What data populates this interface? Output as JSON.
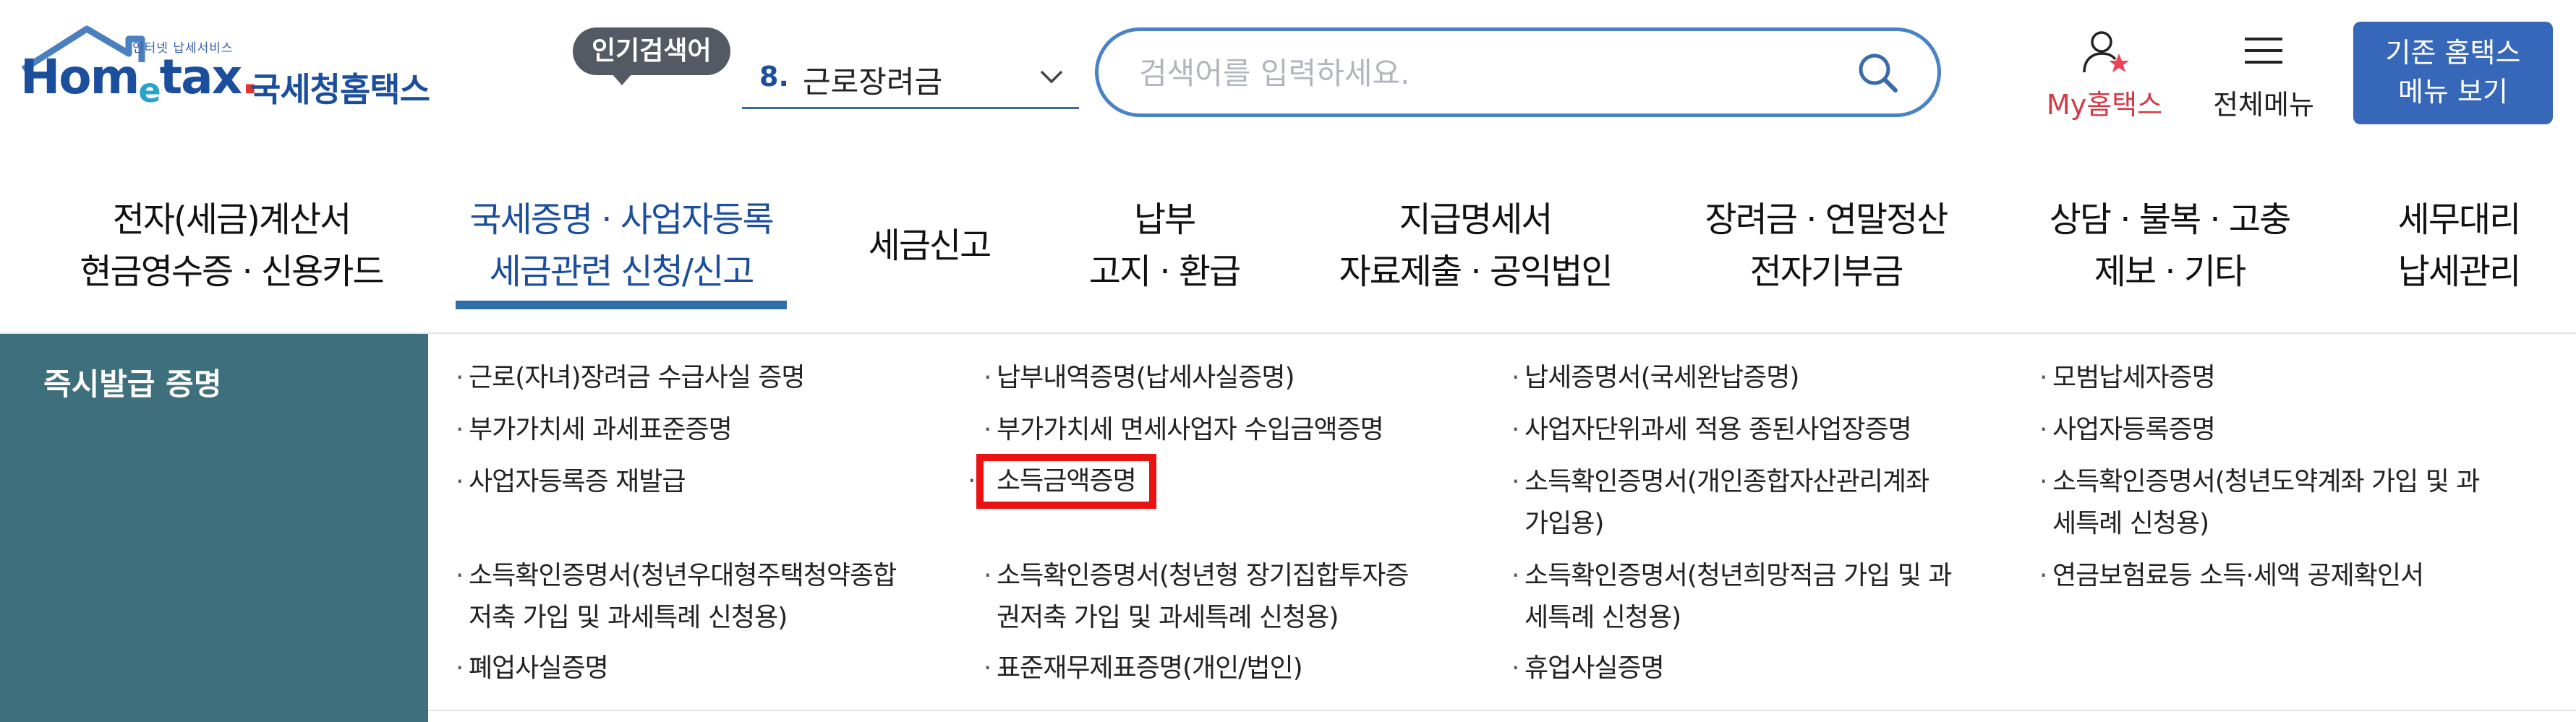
{
  "header": {
    "logo_sub": "인터넷 납세서비스",
    "logo_word_1": "Hom",
    "logo_word_e": "e",
    "logo_word_2": "tax",
    "logo_dot": ".",
    "logo_name": "국세청홈택스",
    "popular_label": "인기검색어",
    "popular_num": "8.",
    "popular_text": "근로장려금",
    "search_placeholder": "검색어를 입력하세요.",
    "my_label": "My홈택스",
    "all_menu_label": "전체메뉴",
    "old_menu_line1": "기존 홈택스",
    "old_menu_line2": "메뉴 보기"
  },
  "gnb": [
    {
      "line1": "전자(세금)계산서",
      "line2": "현금영수증 · 신용카드"
    },
    {
      "line1": "국세증명 · 사업자등록",
      "line2": "세금관련 신청/신고"
    },
    {
      "line1": "세금신고",
      "line2": ""
    },
    {
      "line1": "납부",
      "line2": "고지 · 환급"
    },
    {
      "line1": "지급명세서",
      "line2": "자료제출 · 공익법인"
    },
    {
      "line1": "장려금 · 연말정산",
      "line2": "전자기부금"
    },
    {
      "line1": "상담 · 불복 · 고충",
      "line2": "제보 · 기타"
    },
    {
      "line1": "세무대리",
      "line2": "납세관리"
    }
  ],
  "submenu": {
    "category": "즉시발급 증명",
    "bullet": "·",
    "items": [
      "근로(자녀)장려금 수급사실 증명",
      "납부내역증명(납세사실증명)",
      "납세증명서(국세완납증명)",
      "모범납세자증명",
      "부가가치세 과세표준증명",
      "부가가치세 면세사업자 수입금액증명",
      "사업자단위과세 적용 종된사업장증명",
      "사업자등록증명",
      "사업자등록증 재발급",
      "소득금액증명",
      "소득확인증명서(개인종합자산관리계좌\n가입용)",
      "소득확인증명서(청년도약계좌 가입 및 과\n세특례 신청용)",
      "소득확인증명서(청년우대형주택청약종합\n저축 가입 및 과세특례 신청용)",
      "소득확인증명서(청년형 장기집합투자증\n권저축 가입 및 과세특례 신청용)",
      "소득확인증명서(청년희망적금 가입 및 과\n세특례 신청용)",
      "연금보험료등 소득·세액 공제확인서",
      "폐업사실증명",
      "표준재무제표증명(개인/법인)",
      "휴업사실증명"
    ]
  }
}
